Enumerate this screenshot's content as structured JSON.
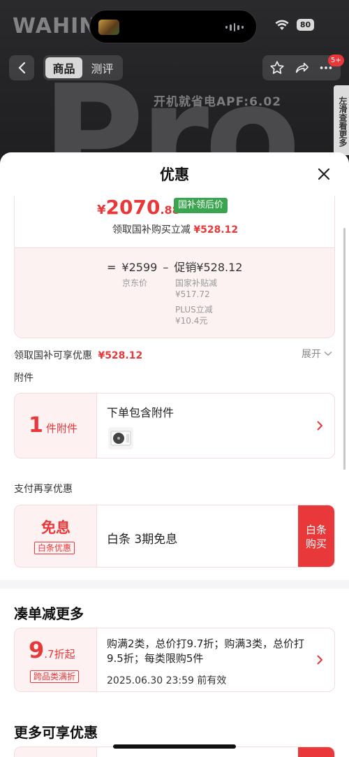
{
  "background": {
    "brand_text": "WAHIN",
    "battery": "80",
    "tabs": [
      {
        "label": "商品",
        "active": true
      },
      {
        "label": "测评",
        "active": false
      }
    ],
    "message_badge": "5+",
    "hero_text": "Pro",
    "apf_text": "开机就省电APF:6.02",
    "side_tag": "左滑查看更多"
  },
  "sheet": {
    "title": "优惠",
    "price": {
      "currency": "¥",
      "integer": "2070",
      "decimal": ".88",
      "badge": "国补领后价",
      "claim_label": "领取国补购买立减",
      "claim_amount": "¥528.12",
      "eq_sign": "=",
      "jd_price": "¥2599",
      "minus_sign": "–",
      "promo_label": "促销¥528.12",
      "jd_price_label": "京东价",
      "subsidy_label": "国家补贴减",
      "subsidy_amount": "¥517.72",
      "plus_label": "PLUS立减",
      "plus_amount": "¥10.4元"
    },
    "subsidy_row": {
      "label": "领取国补可享优惠",
      "amount": "¥528.12",
      "expand": "展开"
    },
    "accessory": {
      "section_label": "附件",
      "count": "1",
      "count_unit": "件附件",
      "title": "下单包含附件"
    },
    "payment": {
      "section_label": "支付再享优惠",
      "left_title": "免息",
      "left_tag": "白条优惠",
      "text": "白条 3期免息",
      "action": "白条购买"
    },
    "bundle": {
      "heading": "凑单减更多",
      "discount_big": "9",
      "discount_small": ".7折起",
      "tag": "跨品类满折",
      "text": "购满2类，总价打9.7折；购满3类，总价打9.5折；每类限购5件",
      "deadline": "2025.06.30 23:59 前有效"
    },
    "more": {
      "heading": "更多可享优惠"
    }
  },
  "colors": {
    "accent": "#e8383a",
    "green_badge": "#3aa54f",
    "pink_bg": "#fdf1f1"
  }
}
